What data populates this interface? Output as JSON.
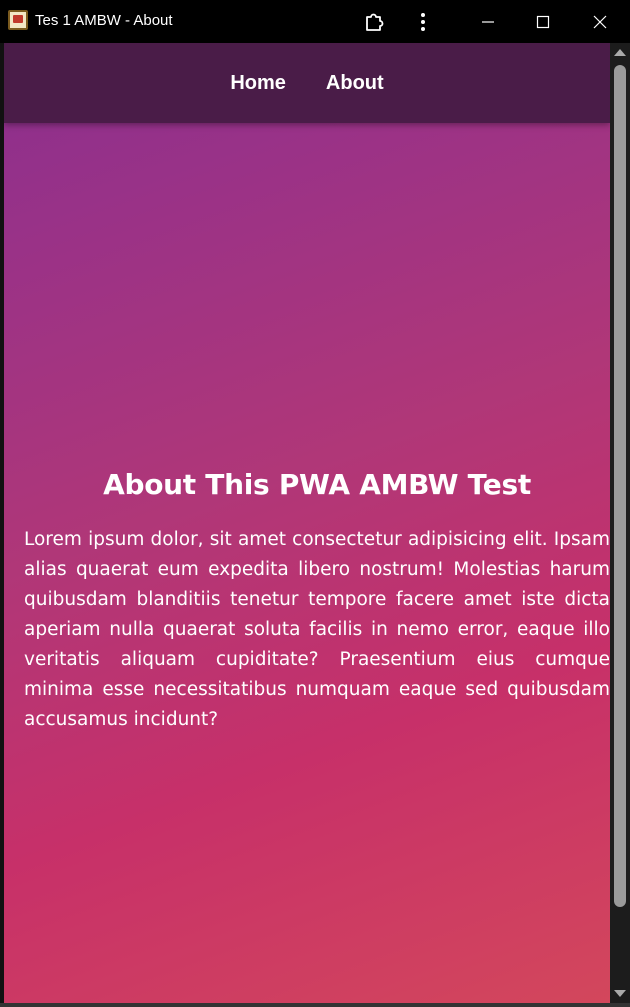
{
  "window": {
    "title": "Tes 1 AMBW - About",
    "icons": {
      "app": "app-icon",
      "extensions": "puzzle-extension-icon",
      "menu": "kebab-menu-icon",
      "minimize": "minimize-icon",
      "maximize": "maximize-icon",
      "close": "close-icon"
    }
  },
  "nav": {
    "items": [
      {
        "label": "Home"
      },
      {
        "label": "About"
      }
    ]
  },
  "main": {
    "heading": "About This PWA AMBW Test",
    "body": "Lorem ipsum dolor, sit amet consectetur adipisicing elit. Ipsam alias quaerat eum expedita libero nostrum! Molestias harum quibusdam blanditiis tenetur tempore facere amet iste dicta aperiam nulla quaerat soluta facilis in nemo error, eaque illo veritatis aliquam cupiditate? Praesentium eius cumque minima esse necessitatibus numquam eaque sed quibusdam accusamus incidunt?"
  },
  "colors": {
    "navbar": "#4a1c48",
    "gradient_start": "#8a2f8e",
    "gradient_end": "#d3475c",
    "text": "#ffffff"
  }
}
